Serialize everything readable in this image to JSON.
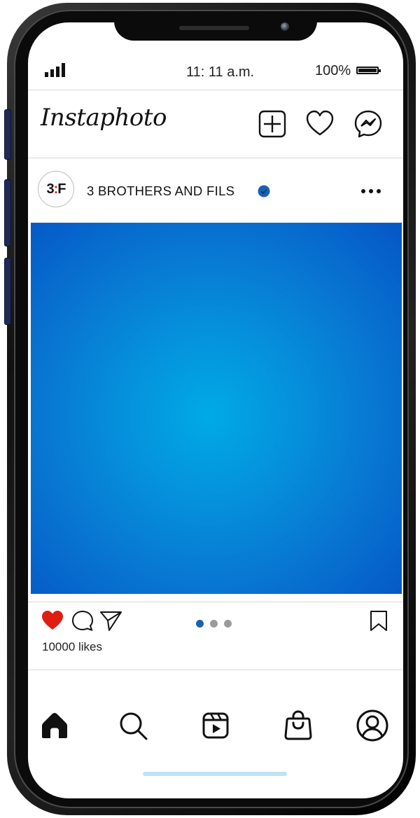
{
  "status_bar": {
    "time": "11: 11 a.m.",
    "battery_percent": "100%"
  },
  "header": {
    "app_title": "Instaphoto",
    "icons": [
      "new-post-icon",
      "heart-icon",
      "messenger-icon"
    ]
  },
  "post": {
    "avatar_text": "3",
    "avatar_separator": ":",
    "avatar_text_end": "F",
    "username": "3 BROTHERS AND FILS",
    "verified": true,
    "image_gradient": [
      "#00aae6",
      "#0556c6"
    ],
    "liked": true,
    "like_color": "#dd1e10",
    "likes_text": "10000 likes",
    "carousel": {
      "count": 3,
      "active_index": 0,
      "active_color": "#1a62b0",
      "inactive_color": "#9a9a9a"
    }
  },
  "bottom_nav": {
    "items": [
      "home-icon",
      "search-icon",
      "reels-icon",
      "shop-icon",
      "profile-icon"
    ],
    "active": "home-icon"
  }
}
